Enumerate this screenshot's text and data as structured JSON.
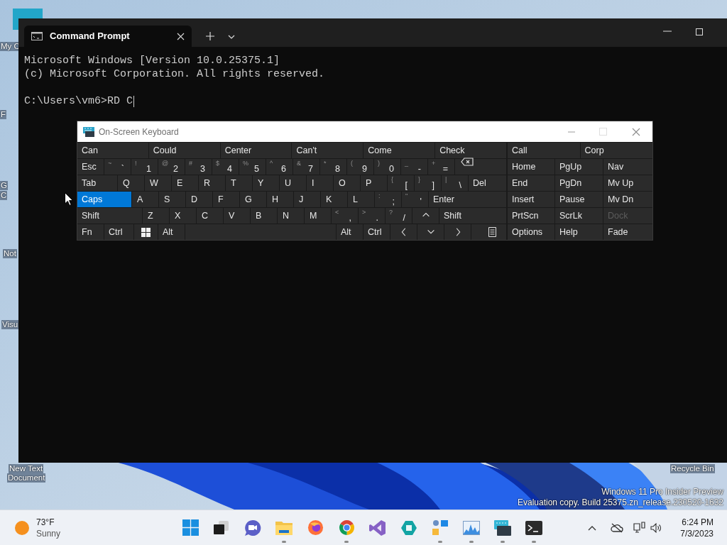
{
  "desktop": {
    "icons": [
      {
        "label": "My C"
      },
      {
        "label": "F"
      },
      {
        "label": "G"
      },
      {
        "label": "C"
      },
      {
        "label": "Not"
      },
      {
        "label": "Visu"
      },
      {
        "label": "New Text"
      },
      {
        "label": "Document"
      },
      {
        "label": "Recycle Bin"
      }
    ],
    "watermark": [
      "Windows 11 Pro Insider Preview",
      "Evaluation copy. Build 25375.zn_release.230520-1632"
    ]
  },
  "terminal": {
    "tab": {
      "title": "Command Prompt",
      "selected": true
    },
    "lines": [
      "Microsoft Windows [Version 10.0.25375.1]",
      "(c) Microsoft Corporation. All rights reserved."
    ],
    "prompt": "C:\\Users\\vm6>RD C"
  },
  "osk": {
    "title": "On-Screen Keyboard",
    "predictions": [
      "Can",
      "Could",
      "Center",
      "Can't",
      "Come",
      "Check"
    ],
    "nav_predictions": [
      "Call",
      "Corp"
    ],
    "rows": [
      {
        "keys": [
          {
            "kind": "text",
            "label": "Esc",
            "on": false
          },
          {
            "kind": "char",
            "shift": "~",
            "label": "`",
            "on": false
          },
          {
            "kind": "char",
            "shift": "!",
            "label": "1",
            "on": false
          },
          {
            "kind": "char",
            "shift": "@",
            "label": "2",
            "on": false
          },
          {
            "kind": "char",
            "shift": "#",
            "label": "3",
            "on": false
          },
          {
            "kind": "char",
            "shift": "$",
            "label": "4",
            "on": false
          },
          {
            "kind": "char",
            "shift": "%",
            "label": "5",
            "on": false
          },
          {
            "kind": "char",
            "shift": "^",
            "label": "6",
            "on": false
          },
          {
            "kind": "char",
            "shift": "&",
            "label": "7",
            "on": false
          },
          {
            "kind": "char",
            "shift": "*",
            "label": "8",
            "on": false
          },
          {
            "kind": "char",
            "shift": "(",
            "label": "9",
            "on": false
          },
          {
            "kind": "char",
            "shift": ")",
            "label": "0",
            "on": false
          },
          {
            "kind": "char",
            "shift": "_",
            "label": "-",
            "on": false
          },
          {
            "kind": "char",
            "shift": "+",
            "label": "=",
            "on": false
          },
          {
            "kind": "backspace",
            "on": false
          }
        ]
      },
      {
        "keys": [
          {
            "kind": "text",
            "label": "Tab",
            "on": false
          },
          {
            "kind": "letter",
            "label": "Q",
            "on": false
          },
          {
            "kind": "letter",
            "label": "W",
            "on": false
          },
          {
            "kind": "letter",
            "label": "E",
            "on": false
          },
          {
            "kind": "letter",
            "label": "R",
            "on": false
          },
          {
            "kind": "letter",
            "label": "T",
            "on": false
          },
          {
            "kind": "letter",
            "label": "Y",
            "on": false
          },
          {
            "kind": "letter",
            "label": "U",
            "on": false
          },
          {
            "kind": "letter",
            "label": "I",
            "on": false
          },
          {
            "kind": "letter",
            "label": "O",
            "on": false
          },
          {
            "kind": "letter",
            "label": "P",
            "on": false
          },
          {
            "kind": "char",
            "shift": "{",
            "label": "[",
            "on": false
          },
          {
            "kind": "char",
            "shift": "}",
            "label": "]",
            "on": false
          },
          {
            "kind": "char",
            "shift": "|",
            "label": "\\",
            "on": false
          },
          {
            "kind": "text",
            "label": "Del",
            "on": false
          }
        ]
      },
      {
        "keys": [
          {
            "kind": "text",
            "label": "Caps",
            "on": true
          },
          {
            "kind": "letter",
            "label": "A",
            "on": false
          },
          {
            "kind": "letter",
            "label": "S",
            "on": false
          },
          {
            "kind": "letter",
            "label": "D",
            "on": false
          },
          {
            "kind": "letter",
            "label": "F",
            "on": false
          },
          {
            "kind": "letter",
            "label": "G",
            "on": false
          },
          {
            "kind": "letter",
            "label": "H",
            "on": false
          },
          {
            "kind": "letter",
            "label": "J",
            "on": false
          },
          {
            "kind": "letter",
            "label": "K",
            "on": false
          },
          {
            "kind": "letter",
            "label": "L",
            "on": false
          },
          {
            "kind": "char",
            "shift": ":",
            "label": ";",
            "on": false
          },
          {
            "kind": "char",
            "shift": "\"",
            "label": "'",
            "on": false
          },
          {
            "kind": "text",
            "label": "Enter",
            "on": false
          }
        ]
      },
      {
        "keys": [
          {
            "kind": "text",
            "label": "Shift",
            "on": false
          },
          {
            "kind": "letter",
            "label": "Z",
            "on": false
          },
          {
            "kind": "letter",
            "label": "X",
            "on": false
          },
          {
            "kind": "letter",
            "label": "C",
            "on": false
          },
          {
            "kind": "letter",
            "label": "V",
            "on": false
          },
          {
            "kind": "letter",
            "label": "B",
            "on": false
          },
          {
            "kind": "letter",
            "label": "N",
            "on": false
          },
          {
            "kind": "letter",
            "label": "M",
            "on": false
          },
          {
            "kind": "char",
            "shift": "<",
            "label": ",",
            "on": false
          },
          {
            "kind": "char",
            "shift": ">",
            "label": ".",
            "on": false
          },
          {
            "kind": "char",
            "shift": "?",
            "label": "/",
            "on": false
          },
          {
            "kind": "arrow-up",
            "on": false
          },
          {
            "kind": "text",
            "label": "Shift",
            "on": false
          }
        ]
      },
      {
        "keys": [
          {
            "kind": "text",
            "label": "Fn",
            "on": false
          },
          {
            "kind": "text",
            "label": "Ctrl",
            "on": false
          },
          {
            "kind": "windows",
            "on": false
          },
          {
            "kind": "text",
            "label": "Alt",
            "on": false
          },
          {
            "kind": "space",
            "on": false
          },
          {
            "kind": "text",
            "label": "Alt",
            "on": false
          },
          {
            "kind": "text",
            "label": "Ctrl",
            "on": false
          },
          {
            "kind": "arrow-left",
            "on": false
          },
          {
            "kind": "arrow-down",
            "on": false
          },
          {
            "kind": "arrow-right",
            "on": false
          },
          {
            "kind": "menu",
            "on": false
          }
        ]
      }
    ],
    "nav_rows": [
      [
        {
          "label": "Home",
          "disabled": false
        },
        {
          "label": "PgUp",
          "disabled": false
        },
        {
          "label": "Nav",
          "disabled": false
        }
      ],
      [
        {
          "label": "End",
          "disabled": false
        },
        {
          "label": "PgDn",
          "disabled": false
        },
        {
          "label": "Mv Up",
          "disabled": false
        }
      ],
      [
        {
          "label": "Insert",
          "disabled": false
        },
        {
          "label": "Pause",
          "disabled": false
        },
        {
          "label": "Mv Dn",
          "disabled": false
        }
      ],
      [
        {
          "label": "PrtScn",
          "disabled": false
        },
        {
          "label": "ScrLk",
          "disabled": false
        },
        {
          "label": "Dock",
          "disabled": true
        }
      ],
      [
        {
          "label": "Options",
          "disabled": false
        },
        {
          "label": "Help",
          "disabled": false
        },
        {
          "label": "Fade",
          "disabled": false
        }
      ]
    ]
  },
  "taskbar": {
    "weather": {
      "temperature": "73°F",
      "condition": "Sunny"
    },
    "apps": [
      {
        "kind": "start",
        "running": false
      },
      {
        "kind": "taskview",
        "running": false
      },
      {
        "kind": "chat",
        "running": false
      },
      {
        "kind": "folder",
        "running": true
      },
      {
        "kind": "firefox",
        "running": false
      },
      {
        "kind": "chrome",
        "running": true
      },
      {
        "kind": "studio",
        "running": false
      },
      {
        "kind": "hexagon",
        "running": false
      },
      {
        "kind": "control",
        "running": true
      },
      {
        "kind": "chart",
        "running": true
      },
      {
        "kind": "keyboard",
        "running": true
      },
      {
        "kind": "terminal",
        "running": true
      }
    ],
    "time": "6:24 PM",
    "date": "7/3/2023"
  }
}
